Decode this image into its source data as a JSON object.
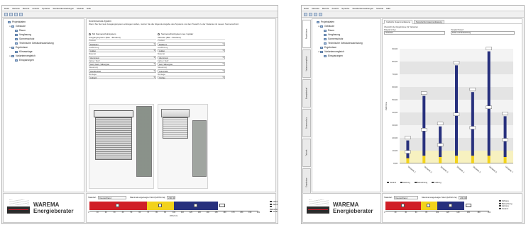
{
  "menu": [
    "Datei",
    "Variante",
    "Bericht",
    "Ansicht",
    "Sprache",
    "Standardeinstellungen",
    "Module",
    "Hilfe"
  ],
  "colors": {
    "red": "#d01f27",
    "yellow": "#f2d21b",
    "navy": "#27307d",
    "black": "#111111",
    "accent": "#5e7fa8"
  },
  "left": {
    "tree": [
      {
        "label": "Projektdaten",
        "indent": 0,
        "exp": "",
        "icon": "project-icon"
      },
      {
        "label": "Gebäude",
        "indent": 1,
        "exp": "⊟",
        "icon": "building-icon"
      },
      {
        "label": "Raum",
        "indent": 2,
        "exp": "",
        "icon": "room-icon"
      },
      {
        "label": "Verglasung",
        "indent": 2,
        "exp": "",
        "icon": "glazing-icon"
      },
      {
        "label": "Sonnenschutz",
        "indent": 2,
        "exp": "",
        "icon": "sunshade-icon"
      },
      {
        "label": "Technische Gebäudeausrüstung",
        "indent": 2,
        "exp": "",
        "icon": "technics-icon"
      },
      {
        "label": "Ergebnisse",
        "indent": 1,
        "exp": "⊟",
        "icon": "results-icon"
      },
      {
        "label": "Klimaanlage",
        "indent": 2,
        "exp": "",
        "icon": "aircon-icon"
      },
      {
        "label": "Variantenvergleich",
        "indent": 1,
        "exp": "⊟",
        "icon": "compare-icon"
      },
      {
        "label": "Einsparungen",
        "indent": 2,
        "exp": "",
        "icon": "savings-icon"
      }
    ],
    "content_title": "Sonnenschutz-System",
    "intro": "Wenn Sie hier kein Ausgangssystem eintragen wollen, nutzen Sie die folgende Angabe des Systems vor dem Tausch zu der Variante mit neuem Sonnenschutz.",
    "radio_left": "Mit Sonnenschutzsystem",
    "radio_right": "Sonnenschutzsystem neu / später",
    "col_left": {
      "head": "Ausgangssystem (Bau - Bestand)",
      "fields": [
        {
          "label": "Produkt",
          "value": "Rollladen"
        },
        {
          "label": "Ausführung",
          "value": "Außen"
        },
        {
          "label": "Material",
          "value": "Aluminium"
        },
        {
          "label": "Farbe / Stoff",
          "value": "Hell, Weiß, Silbergrau"
        },
        {
          "label": "Steuerung",
          "value": "Handbetrieb"
        },
        {
          "label": "Montage",
          "value": "Aufsatz"
        }
      ]
    },
    "col_right": {
      "head": "Variante (Bau - Bestand)",
      "fields": [
        {
          "label": "Produkt",
          "value": "Raffstore"
        },
        {
          "label": "Ausführung",
          "value": "Außen"
        },
        {
          "label": "Material",
          "value": "Aluminium"
        },
        {
          "label": "Farbe / Stoff",
          "value": "Hell, Silbergrau"
        },
        {
          "label": "Steuerung",
          "value": "Automatik"
        },
        {
          "label": "Montage",
          "value": "Vorbau"
        }
      ]
    },
    "bottom": {
      "label_location": "Standort",
      "location": "Deutschland",
      "label_max": "Maximal angezeigter Wert [kWh/m²a]",
      "max_value": "200,00",
      "axis_label": "kWh/m²a",
      "legend": [
        "Kühlung",
        "Heizung",
        "Beleuchtung",
        "Gesamt"
      ]
    }
  },
  "brand": {
    "logo_text": "warema",
    "name": "WAREMA\nEnergieberater"
  },
  "right": {
    "vtabs": [
      "Projektdaten",
      "Variantenvergleich",
      "Energiebedarf",
      "Sonnenschutz",
      "Technik",
      "Ergebnisse"
    ],
    "tree": [
      {
        "label": "Projektdaten",
        "indent": 0,
        "exp": "",
        "icon": "project-icon"
      },
      {
        "label": "Gebäude",
        "indent": 1,
        "exp": "⊟",
        "icon": "building-icon"
      },
      {
        "label": "Raum",
        "indent": 2,
        "exp": "",
        "icon": "room-icon"
      },
      {
        "label": "Verglasung",
        "indent": 2,
        "exp": "",
        "icon": "glazing-icon"
      },
      {
        "label": "Sonnenschutz",
        "indent": 2,
        "exp": "",
        "icon": "sunshade-icon"
      },
      {
        "label": "Technische Gebäudeausrüstung",
        "indent": 2,
        "exp": "",
        "icon": "technics-icon"
      },
      {
        "label": "Ergebnisse",
        "indent": 1,
        "exp": "",
        "icon": "results-icon"
      },
      {
        "label": "Variantenvergleich",
        "indent": 1,
        "exp": "⊟",
        "icon": "compare-icon"
      },
      {
        "label": "Einsparungen",
        "indent": 2,
        "exp": "",
        "icon": "savings-icon"
      }
    ],
    "tabs": [
      "Grafische Zusammenfassung",
      "Numerische Zusammenfassung"
    ],
    "caption": "Übersicht der Ergebnisse für Varianten",
    "label_diagram": "Diagrammtyp",
    "diagram_type": "Varianten",
    "label_compare": "Vergleichswert",
    "compare_value": "Kälte und Beleuchtung",
    "ylabel": "kWh/m²a",
    "legend": [
      "Gesamt",
      "Heizung",
      "Beleuchtung",
      "Kühlung"
    ],
    "bottom": {
      "label_location": "Standort",
      "location": "Deutschland",
      "label_max": "Maximal angezeigter Wert [kWh/m²a]",
      "max_value": "200,00",
      "legend": [
        "Kühlung",
        "Beleuchtung",
        "Heizung",
        "Gesamt"
      ]
    }
  },
  "chart_data": [
    {
      "type": "bar",
      "orientation": "horizontal-stacked",
      "xlabel": "kWh/m²a",
      "xlim": [
        0,
        200
      ],
      "x_ticks": [
        0,
        10,
        20,
        30,
        40,
        50,
        60,
        70,
        80,
        90,
        100,
        110,
        120,
        130,
        140,
        150,
        160,
        170,
        180,
        190,
        200
      ],
      "series": [
        {
          "name": "Heizung",
          "color": "#d01f27",
          "value": 68
        },
        {
          "name": "Beleuchtung",
          "color": "#f2d21b",
          "value": 32
        },
        {
          "name": "Kühlung",
          "color": "#27307d",
          "value": 52
        }
      ],
      "marker_total": 152
    },
    {
      "type": "bar",
      "orientation": "vertical-stacked",
      "ylabel": "kWh/m²a",
      "ylim": [
        0,
        90
      ],
      "y_ticks": [
        0,
        10,
        20,
        30,
        40,
        50,
        60,
        70,
        80,
        90
      ],
      "categories": [
        "Variante 1",
        "Variante 2",
        "Variante 3",
        "Variante 4",
        "Variante 5",
        "Variante 6",
        "Variante 7"
      ],
      "series": [
        {
          "name": "Beleuchtung",
          "color": "#f2d21b",
          "values": [
            4,
            6,
            5,
            6,
            6,
            6,
            5
          ]
        },
        {
          "name": "Kühlung",
          "color": "#27307d",
          "values": [
            14,
            47,
            24,
            71,
            50,
            82,
            32
          ]
        }
      ]
    },
    {
      "type": "bar",
      "orientation": "horizontal-stacked",
      "xlim": [
        0,
        200
      ],
      "x_ticks": [
        0,
        20,
        40,
        60,
        80,
        100,
        120,
        140,
        160,
        180,
        200
      ],
      "series": [
        {
          "name": "Heizung",
          "color": "#d01f27",
          "value": 68
        },
        {
          "name": "Beleuchtung",
          "color": "#f2d21b",
          "value": 32
        },
        {
          "name": "Kühlung",
          "color": "#27307d",
          "value": 52
        }
      ],
      "marker_total": 152
    }
  ]
}
